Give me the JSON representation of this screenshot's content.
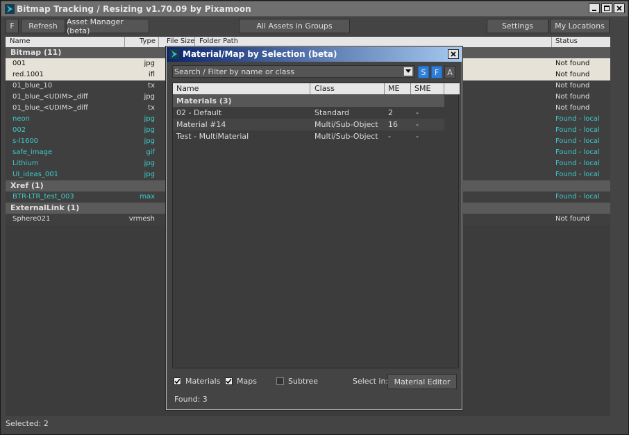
{
  "window": {
    "title": "Bitmap Tracking / Resizing v1.70.09 by Pixamoon"
  },
  "toolbar": {
    "f_label": "F",
    "refresh_label": "Refresh",
    "asset_manager_label": "Asset Manager (beta)",
    "groups_label": "All Assets in Groups",
    "settings_label": "Settings",
    "locations_label": "My Locations"
  },
  "columns": {
    "name": "Name",
    "type": "Type",
    "file_size": "File Size",
    "folder_path": "Folder Path",
    "status": "Status"
  },
  "groups": [
    {
      "label": "Bitmap (11)"
    },
    {
      "label": "Xref (1)"
    },
    {
      "label": "ExternalLink (1)"
    }
  ],
  "rows": [
    {
      "name": "001",
      "type": "jpg",
      "status": "Not found"
    },
    {
      "name": "red.1001",
      "type": "ifl",
      "status": "Not found"
    },
    {
      "name": "01_blue_10",
      "type": "tx",
      "status": "Not found"
    },
    {
      "name": "01_blue_<UDIM>_diff",
      "type": "jpg",
      "status": "Not found"
    },
    {
      "name": "01_blue_<UDIM>_diff",
      "type": "tx",
      "status": "Not found"
    },
    {
      "name": "neon",
      "type": "jpg",
      "status": "Found - local"
    },
    {
      "name": "002",
      "type": "jpg",
      "status": "Found - local"
    },
    {
      "name": "s-l1600",
      "type": "jpg",
      "status": "Found - local"
    },
    {
      "name": "safe_image",
      "type": "gif",
      "status": "Found - local"
    },
    {
      "name": "Lithium",
      "type": "jpg",
      "status": "Found - local"
    },
    {
      "name": "UI_ideas_001",
      "type": "jpg",
      "status": "Found - local"
    },
    {
      "name": "BTR-LTR_test_003",
      "type": "max",
      "status": "Found - local"
    },
    {
      "name": "Sphere021",
      "type": "vrmesh",
      "status": "Not found"
    }
  ],
  "status_bar": {
    "text": "Selected: 2"
  },
  "dialog": {
    "title": "Material/Map by Selection (beta)",
    "search_placeholder": "Search / Filter by name or class",
    "filter_s": "S",
    "filter_f": "F",
    "filter_a": "A",
    "columns": {
      "name": "Name",
      "class": "Class",
      "me": "ME",
      "sme": "SME"
    },
    "group_label": "Materials (3)",
    "materials": [
      {
        "name": "02 - Default",
        "class": "Standard",
        "me": "2",
        "sme": "-"
      },
      {
        "name": "Material #14",
        "class": "Multi/Sub-Object",
        "me": "16",
        "sme": "-"
      },
      {
        "name": "Test - MultiMaterial",
        "class": "Multi/Sub-Object",
        "me": "-",
        "sme": "-"
      }
    ],
    "options": {
      "materials_label": "Materials",
      "maps_label": "Maps",
      "subtree_label": "Subtree",
      "select_in_label": "Select in:",
      "material_editor_label": "Material Editor"
    },
    "found_text": "Found: 3"
  },
  "colors": {
    "found": "#3fc9c9",
    "filter_on": "#2f7fd8",
    "dialog_title": "#0a246a"
  },
  "icons": [
    "app-logo-icon",
    "minimize-icon",
    "maximize-icon",
    "close-icon",
    "dropdown-arrow-icon",
    "checkmark-icon"
  ]
}
